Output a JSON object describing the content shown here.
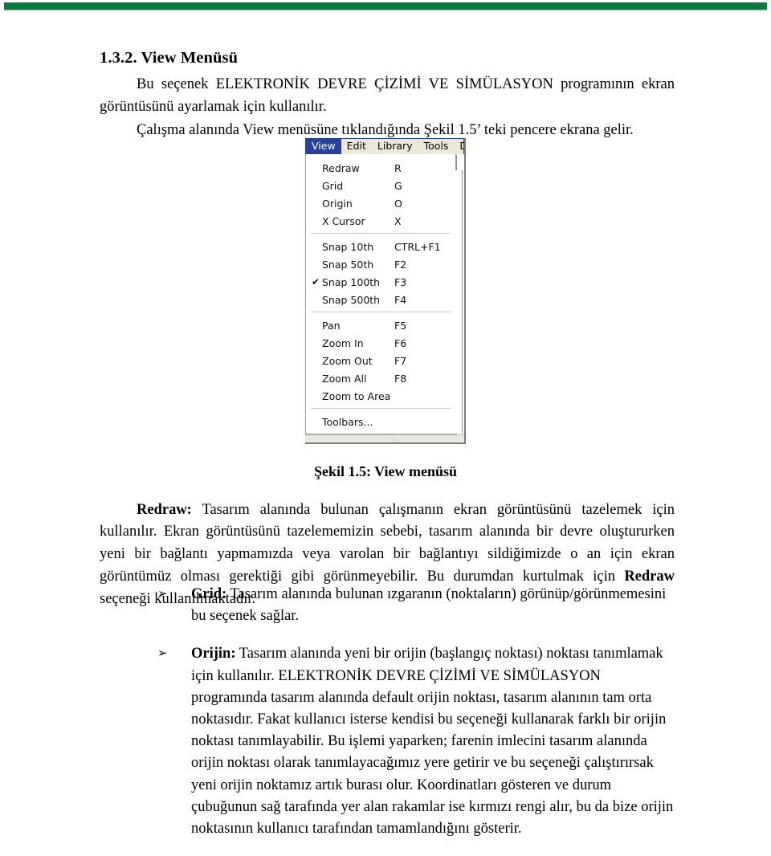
{
  "page": {
    "accent_color": "#0a7a41",
    "heading": "1.3.2. View Menüsü",
    "intro_p1": "Bu seçenek ELEKTRONİK DEVRE ÇİZİMİ VE SİMÜLASYON programının ekran görüntüsünü ayarlamak için kullanılır.",
    "intro_p2": "Çalışma alanında View menüsüne tıklandığında Şekil 1.5’ teki pencere ekrana gelir.",
    "figure_caption": "Şekil 1.5: View menüsü"
  },
  "figure": {
    "menubar": [
      {
        "label": "View",
        "active": true
      },
      {
        "label": "Edit",
        "active": false
      },
      {
        "label": "Library",
        "active": false
      },
      {
        "label": "Tools",
        "active": false
      },
      {
        "label": "De",
        "active": false
      }
    ],
    "menu_groups": [
      {
        "items": [
          {
            "checked": "",
            "label": "Redraw",
            "accel": "R"
          },
          {
            "checked": "",
            "label": "Grid",
            "accel": "G"
          },
          {
            "checked": "",
            "label": "Origin",
            "accel": "O"
          },
          {
            "checked": "",
            "label": "X Cursor",
            "accel": "X"
          }
        ]
      },
      {
        "items": [
          {
            "checked": "",
            "label": "Snap 10th",
            "accel": "CTRL+F1"
          },
          {
            "checked": "",
            "label": "Snap 50th",
            "accel": "F2"
          },
          {
            "checked": "✔",
            "label": "Snap 100th",
            "accel": "F3"
          },
          {
            "checked": "",
            "label": "Snap 500th",
            "accel": "F4"
          }
        ]
      },
      {
        "items": [
          {
            "checked": "",
            "label": "Pan",
            "accel": "F5"
          },
          {
            "checked": "",
            "label": "Zoom In",
            "accel": "F6"
          },
          {
            "checked": "",
            "label": "Zoom Out",
            "accel": "F7"
          },
          {
            "checked": "",
            "label": "Zoom All",
            "accel": "F8"
          },
          {
            "checked": "",
            "label": "Zoom to Area",
            "accel": ""
          }
        ]
      },
      {
        "items": [
          {
            "checked": "",
            "label": "Toolbars...",
            "accel": ""
          }
        ]
      }
    ],
    "resize_grip": "⸬"
  },
  "body": {
    "redraw": {
      "term": "Redraw:",
      "text_a": " Tasarım alanında bulunan çalışmanın ekran görüntüsünü tazelemek için kullanılır. Ekran görüntüsünü tazelememizin sebebi, tasarım alanında bir devre oluştururken yeni bir bağlantı yapmamızda veya varolan bir bağlantıyı sildiğimizde o an için ekran görüntümüz olması gerektiği gibi görünmeyebilir. Bu durumdan kurtulmak için ",
      "term_inline": "Redraw",
      "text_b": " seçeneği kullanılmaktadır."
    },
    "bullets": [
      {
        "marker": "➢",
        "term": "Grid:",
        "text": " Tasarım alanında bulunan ızgaranın (noktaların) görünüp/görünmemesini bu seçenek sağlar."
      },
      {
        "marker": "➢",
        "term": "Orijin:",
        "text": " Tasarım alanında yeni bir orijin (başlangıç noktası) noktası tanımlamak için kullanılır. ELEKTRONİK DEVRE ÇİZİMİ VE SİMÜLASYON programında tasarım alanında default orijin noktası, tasarım alanının tam orta noktasıdır. Fakat kullanıcı isterse kendisi bu seçeneği kullanarak farklı bir orijin noktası tanımlayabilir. Bu işlemi yaparken; farenin imlecini tasarım alanında orijin noktası olarak tanımlayacağımız yere getirir ve bu seçeneği çalıştırırsak yeni orijin noktamız artık burası olur. Koordinatları gösteren ve durum çubuğunun sağ tarafında yer alan rakamlar ise kırmızı rengi alır, bu da bize orijin noktasının kullanıcı tarafından tamamlandığını gösterir."
      }
    ]
  }
}
